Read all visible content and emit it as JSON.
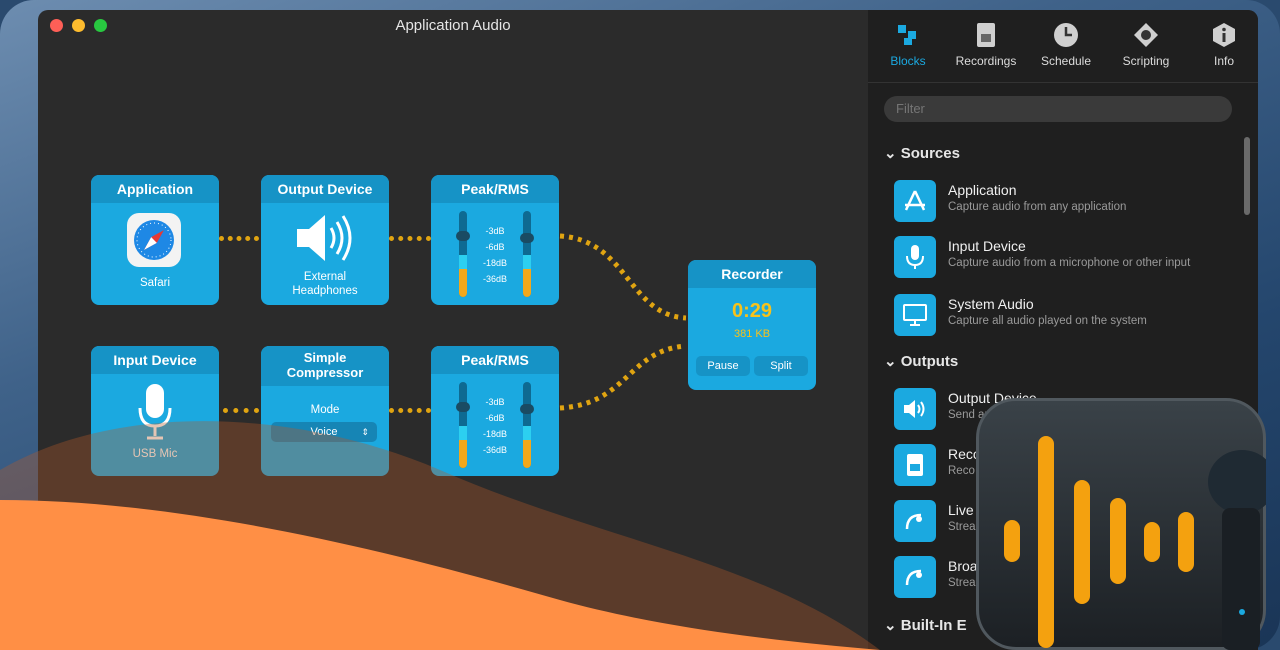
{
  "window": {
    "title": "Application Audio"
  },
  "blocks": {
    "app": {
      "title": "Application",
      "label": "Safari"
    },
    "output": {
      "title": "Output Device",
      "label_line1": "External",
      "label_line2": "Headphones"
    },
    "peak1": {
      "title": "Peak/RMS",
      "levels": [
        "-3dB",
        "-6dB",
        "-18dB",
        "-36dB"
      ]
    },
    "recorder": {
      "title": "Recorder",
      "time": "0:29",
      "size": "381 KB",
      "pause": "Pause",
      "split": "Split"
    },
    "input": {
      "title": "Input Device",
      "label": "USB Mic"
    },
    "compressor": {
      "title_line1": "Simple",
      "title_line2": "Compressor",
      "mode_label": "Mode",
      "mode_value": "Voice"
    },
    "peak2": {
      "title": "Peak/RMS",
      "levels": [
        "-3dB",
        "-6dB",
        "-18dB",
        "-36dB"
      ]
    }
  },
  "toolbar": [
    {
      "label": "Blocks",
      "icon": "blocks-icon",
      "active": true
    },
    {
      "label": "Recordings",
      "icon": "recordings-icon"
    },
    {
      "label": "Schedule",
      "icon": "clock-icon"
    },
    {
      "label": "Scripting",
      "icon": "scripting-icon"
    },
    {
      "label": "Info",
      "icon": "info-icon"
    }
  ],
  "filter": {
    "placeholder": "Filter"
  },
  "sections": {
    "sources": "Sources",
    "outputs": "Outputs",
    "builtin": "Built-In E"
  },
  "sources": [
    {
      "name": "Application",
      "desc": "Capture audio from any application"
    },
    {
      "name": "Input Device",
      "desc": "Capture audio from a microphone or other input"
    },
    {
      "name": "System Audio",
      "desc": "Capture all audio played on the system"
    }
  ],
  "outputs": [
    {
      "name": "Output Device",
      "desc": "Send au"
    },
    {
      "name": "Reco",
      "desc": "Reco"
    },
    {
      "name": "Live",
      "desc": "Strea"
    },
    {
      "name": "Broa",
      "desc": "Strea"
    }
  ],
  "colors": {
    "accent": "#1ba9e0",
    "meter": "#f2a81b",
    "wire": "#e0a411",
    "orange": "#ff8f45",
    "timer": "#f7c21b"
  }
}
